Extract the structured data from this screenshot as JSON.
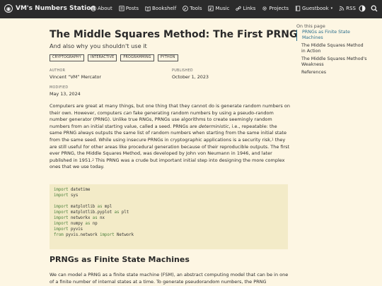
{
  "nav": {
    "brand": "VM's Numbers Station",
    "links": [
      {
        "label": "About",
        "icon": "info-icon"
      },
      {
        "label": "Posts",
        "icon": "list-icon"
      },
      {
        "label": "Bookshelf",
        "icon": "book-icon"
      },
      {
        "label": "Tools",
        "icon": "wrench-icon"
      },
      {
        "label": "Music",
        "icon": "music-icon"
      },
      {
        "label": "Links",
        "icon": "link-icon"
      },
      {
        "label": "Projects",
        "icon": "gear-icon"
      },
      {
        "label": "Guestbook",
        "icon": "book-icon"
      },
      {
        "label": "RSS",
        "icon": "rss-icon"
      }
    ]
  },
  "article": {
    "title": "The Middle Squares Method: The First PRNG",
    "subtitle": "And also why you shouldn't use it",
    "tags": [
      "CRYPTOGRAPHY",
      "INTERACTIVE",
      "PROGRAMMING",
      "PYTHON"
    ],
    "author_label": "AUTHOR",
    "author": "Vincent “VM” Mercator",
    "published_label": "PUBLISHED",
    "published": "October 1, 2023",
    "modified_label": "MODIFIED",
    "modified": "May 13, 2024",
    "intro": {
      "p1": "Computers are great at many things, but one thing that they cannot do is generate random numbers on their own. However, computers ",
      "p1_em": "can",
      "p2": " fake generating random numbers by using a pseudo-random number generator (PRNG). Unlike true RNGs, PRNGs use algorithms to create seemingly random numbers from an initial starting value, called a seed. PRNGs are ",
      "p2_em": "deterministic",
      "p3": ", i.e., repeatable: the same PRNG always outputs the same list of random numbers when starting from the same initial state from the same seed. While using insecure PRNGs in cryptographic applications is a security risk,",
      "fn1": "1",
      "p4": " they are still useful for other areas like procedural generation because of their reproducible outputs. The first ever PRNG, the Middle Squares Method, was developed by John von Neumann in 1946, and later published in 1951.",
      "fn2": "2",
      "p5": " This PRNG was a crude but important initial step into designing the more complex ones that we use today."
    },
    "code": [
      {
        "kw": "import",
        "rest": " datetime"
      },
      {
        "kw": "import",
        "rest": " sys"
      },
      {
        "kw": "",
        "rest": ""
      },
      {
        "kw": "import",
        "rest": " matplotlib ",
        "kw2": "as",
        "rest2": " mpl"
      },
      {
        "kw": "import",
        "rest": " matplotlib.pyplot ",
        "kw2": "as",
        "rest2": " plt"
      },
      {
        "kw": "import",
        "rest": " networkx ",
        "kw2": "as",
        "rest2": " nx"
      },
      {
        "kw": "import",
        "rest": " numpy ",
        "kw2": "as",
        "rest2": " np"
      },
      {
        "kw": "import",
        "rest": " pyvis"
      },
      {
        "kw": "from",
        "rest": " pyvis.network ",
        "kw2": "import",
        "rest2": " Network"
      }
    ],
    "section_heading": "PRNGs as Finite State Machines",
    "section_text": "We can model a PRNG as a finite state machine (FSM), an abstract computing model that can be in one of a finite number of internal states at a time. To generate pseudorandom numbers, the PRNG"
  },
  "toc": {
    "title": "On this page",
    "items": [
      "PRNGs as Finite State Machines",
      "The Middle Squares Method in Action",
      "The Middle Squares Method's Weakness",
      "References"
    ],
    "active_index": 0
  },
  "colors": {
    "background": "#fdf6e3",
    "nav_background": "#2b2b2b",
    "code_background": "#f3ebc8",
    "keyword": "#4b7f3a",
    "toc_active": "#2b6e8c"
  }
}
